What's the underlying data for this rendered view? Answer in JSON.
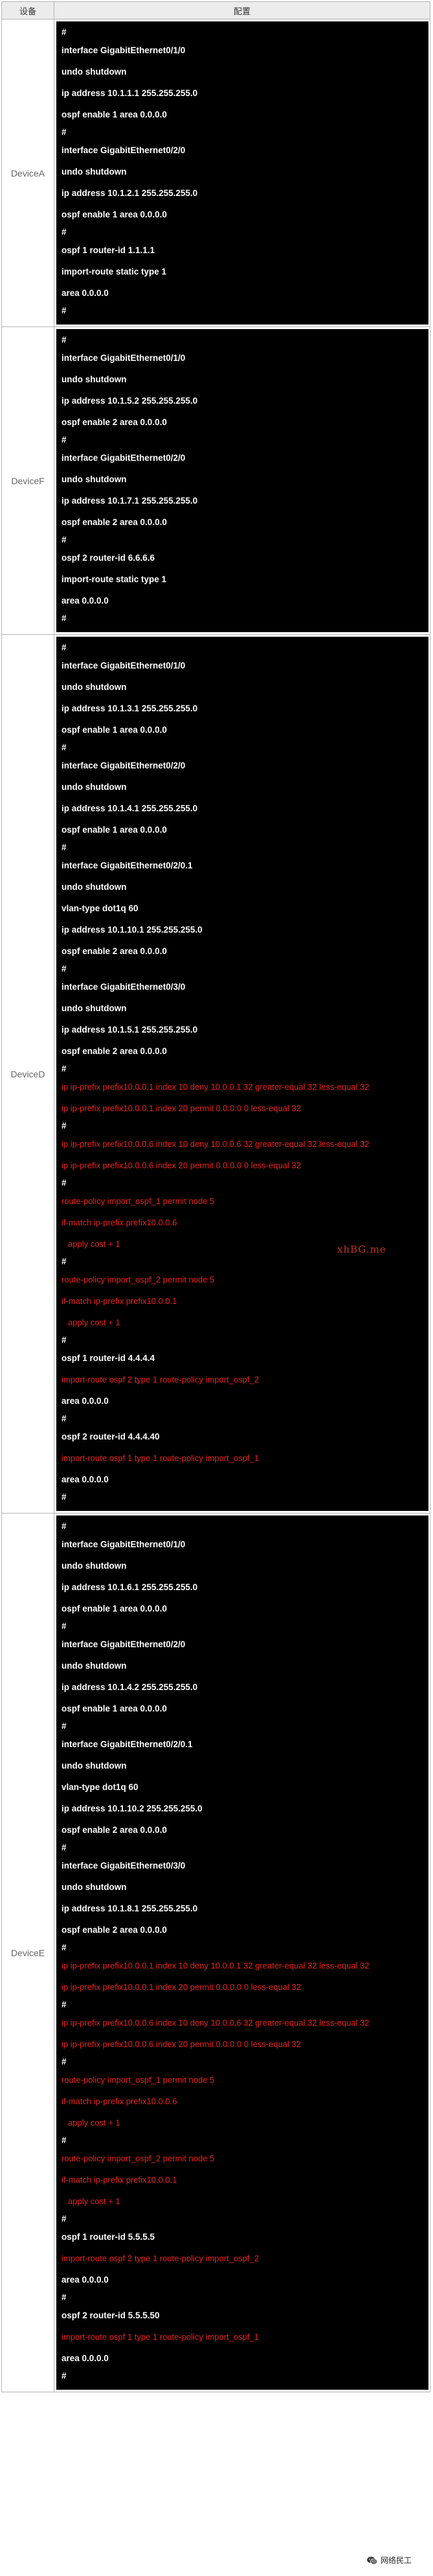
{
  "table": {
    "headers": {
      "device": "设备",
      "config": "配置"
    },
    "rows": [
      {
        "device": "DeviceA",
        "lines": [
          "#",
          "interface GigabitEthernet0/1/0",
          "undo shutdown",
          "ip address 10.1.1.1 255.255.255.0",
          "ospf enable 1 area 0.0.0.0",
          "#",
          "interface GigabitEthernet0/2/0",
          "undo shutdown",
          "ip address 10.1.2.1 255.255.255.0",
          "ospf enable 1 area 0.0.0.0",
          "#",
          "ospf 1 router-id 1.1.1.1",
          "import-route static type 1",
          "area 0.0.0.0",
          "#"
        ]
      },
      {
        "device": "DeviceF",
        "lines": [
          "#",
          "interface GigabitEthernet0/1/0",
          "undo shutdown",
          "ip address 10.1.5.2 255.255.255.0",
          "ospf enable 2 area 0.0.0.0",
          "#",
          "interface GigabitEthernet0/2/0",
          "undo shutdown",
          "ip address 10.1.7.1 255.255.255.0",
          "ospf enable 2 area 0.0.0.0",
          "#",
          "ospf 2 router-id 6.6.6.6",
          "import-route static type 1",
          "area 0.0.0.0",
          "#"
        ]
      },
      {
        "device": "DeviceD",
        "lines": [
          "#",
          "interface GigabitEthernet0/1/0",
          "undo shutdown",
          "ip address 10.1.3.1 255.255.255.0",
          "ospf enable 1 area 0.0.0.0",
          "#",
          "interface GigabitEthernet0/2/0",
          "undo shutdown",
          "ip address 10.1.4.1 255.255.255.0",
          "ospf enable 1 area 0.0.0.0",
          "#",
          "interface GigabitEthernet0/2/0.1",
          "undo shutdown",
          "vlan-type dot1q 60",
          "ip address 10.1.10.1 255.255.255.0",
          "ospf enable 2 area 0.0.0.0",
          "#",
          "interface GigabitEthernet0/3/0",
          "undo shutdown",
          "ip address 10.1.5.1 255.255.255.0",
          "ospf enable 2 area 0.0.0.0",
          "#",
          "ip ip-prefix prefix10.0.0.1 index 10 deny 10.0.0.1 32 greater-equal 32 less-equal 32",
          "ip ip-prefix prefix10.0.0.1 index 20 permit 0.0.0.0 0 less-equal 32",
          "#",
          "ip ip-prefix prefix10.0.0.6 index 10 deny 10.0.0.6 32 greater-equal 32 less-equal 32",
          "ip ip-prefix prefix10.0.0.6 index 20 permit 0.0.0.0 0 less-equal 32",
          "#",
          "route-policy import_ospf_1 permit node 5",
          "if-match ip-prefix prefix10.0.0.6",
          "apply cost + 1",
          "#",
          "route-policy import_ospf_2 permit node 5",
          "if-match ip-prefix prefix10.0.0.1",
          "apply cost + 1",
          "#",
          "ospf 1 router-id 4.4.4.4",
          "import-route ospf 2 type 1 route-policy import_ospf_2",
          "area 0.0.0.0",
          "#",
          "ospf 2 router-id 4.4.4.40",
          "import-route ospf 1 type 1 route-policy import_ospf_1",
          "area 0.0.0.0",
          "#"
        ]
      },
      {
        "device": "DeviceE",
        "lines": [
          "#",
          "interface GigabitEthernet0/1/0",
          "undo shutdown",
          "ip address 10.1.6.1 255.255.255.0",
          "ospf enable 1 area 0.0.0.0",
          "#",
          "interface GigabitEthernet0/2/0",
          "undo shutdown",
          "ip address 10.1.4.2 255.255.255.0",
          "ospf enable 1 area 0.0.0.0",
          "#",
          "interface GigabitEthernet0/2/0.1",
          "undo shutdown",
          "vlan-type dot1q 60",
          "ip address 10.1.10.2 255.255.255.0",
          "ospf enable 2 area 0.0.0.0",
          "#",
          "interface GigabitEthernet0/3/0",
          "undo shutdown",
          "ip address 10.1.8.1 255.255.255.0",
          "ospf enable 2 area 0.0.0.0",
          "#",
          "ip ip-prefix prefix10.0.0.1 index 10 deny 10.0.0.1 32 greater-equal 32 less-equal 32",
          "ip ip-prefix prefix10.0.0.1 index 20 permit 0.0.0.0 0 less-equal 32",
          "#",
          "ip ip-prefix prefix10.0.0.6 index 10 deny 10.0.0.6 32 greater-equal 32 less-equal 32",
          "ip ip-prefix prefix10.0.0.6 index 20 permit 0.0.0.0 0 less-equal 32",
          "#",
          "route-policy import_ospf_1 permit node 5",
          "if-match ip-prefix prefix10.0.0.6",
          "apply cost + 1",
          "#",
          "route-policy import_ospf_2 permit node 5",
          "if-match ip-prefix prefix10.0.0.1",
          "apply cost + 1",
          "#",
          "ospf 1 router-id 5.5.5.5",
          "import-route ospf 2 type 1 route-policy import_ospf_2",
          "area 0.0.0.0",
          "#",
          "ospf 2 router-id 5.5.5.50",
          "import-route ospf 1 type 1 route-policy import_ospf_1",
          "area 0.0.0.0",
          "#"
        ]
      }
    ]
  },
  "watermark": {
    "text": "xhBG.me"
  },
  "brand": {
    "text": "网络民工",
    "icon": "wechat-icon"
  },
  "colors": {
    "highlight": "#e8231f",
    "code_bg": "#000000",
    "code_text": "#ffffff"
  }
}
